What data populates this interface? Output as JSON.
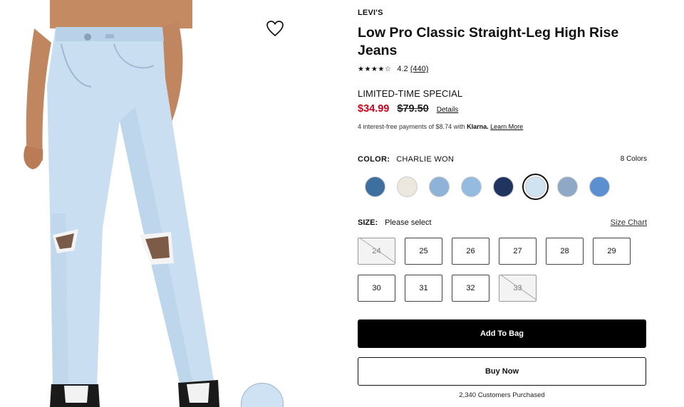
{
  "product": {
    "brand": "LEVI'S",
    "title": "Low Pro Classic Straight-Leg High Rise Jeans",
    "rating_value": "4.2",
    "review_count": "(440)",
    "stars": "★★★★☆"
  },
  "pricing": {
    "promo_label": "LIMITED-TIME SPECIAL",
    "sale_price": "$34.99",
    "original_price": "$79.50",
    "details_label": "Details",
    "klarna_prefix": "4 interest-free payments of $8.74 with ",
    "klarna_brand": "Klarna.",
    "klarna_link": "Learn More"
  },
  "color": {
    "label": "COLOR:",
    "selected": "CHARLIE WON",
    "count_label": "8 Colors",
    "swatches": [
      {
        "name": "dark-indigo",
        "hex": "#3f6f9f"
      },
      {
        "name": "ecru",
        "hex": "#ece8df"
      },
      {
        "name": "mid-blue",
        "hex": "#8fb3d8"
      },
      {
        "name": "light-mid-blue",
        "hex": "#94bbe0"
      },
      {
        "name": "navy",
        "hex": "#1f3560"
      },
      {
        "name": "charlie-won",
        "hex": "#cfe3f1",
        "selected": true
      },
      {
        "name": "faded-blue",
        "hex": "#8ea8c6"
      },
      {
        "name": "bright-blue",
        "hex": "#5b8fd0"
      }
    ]
  },
  "size": {
    "label": "SIZE:",
    "prompt": "Please select",
    "chart_label": "Size Chart",
    "options": [
      {
        "label": "24",
        "available": false
      },
      {
        "label": "25",
        "available": true
      },
      {
        "label": "26",
        "available": true
      },
      {
        "label": "27",
        "available": true
      },
      {
        "label": "28",
        "available": true
      },
      {
        "label": "29",
        "available": true
      },
      {
        "label": "30",
        "available": true
      },
      {
        "label": "31",
        "available": true
      },
      {
        "label": "32",
        "available": true
      },
      {
        "label": "33",
        "available": false
      }
    ]
  },
  "actions": {
    "add_to_bag": "Add To Bag",
    "buy_now": "Buy Now",
    "purchased_count": "2,340 Customers Purchased"
  },
  "icons": {
    "favorite": "heart-outline-icon"
  }
}
